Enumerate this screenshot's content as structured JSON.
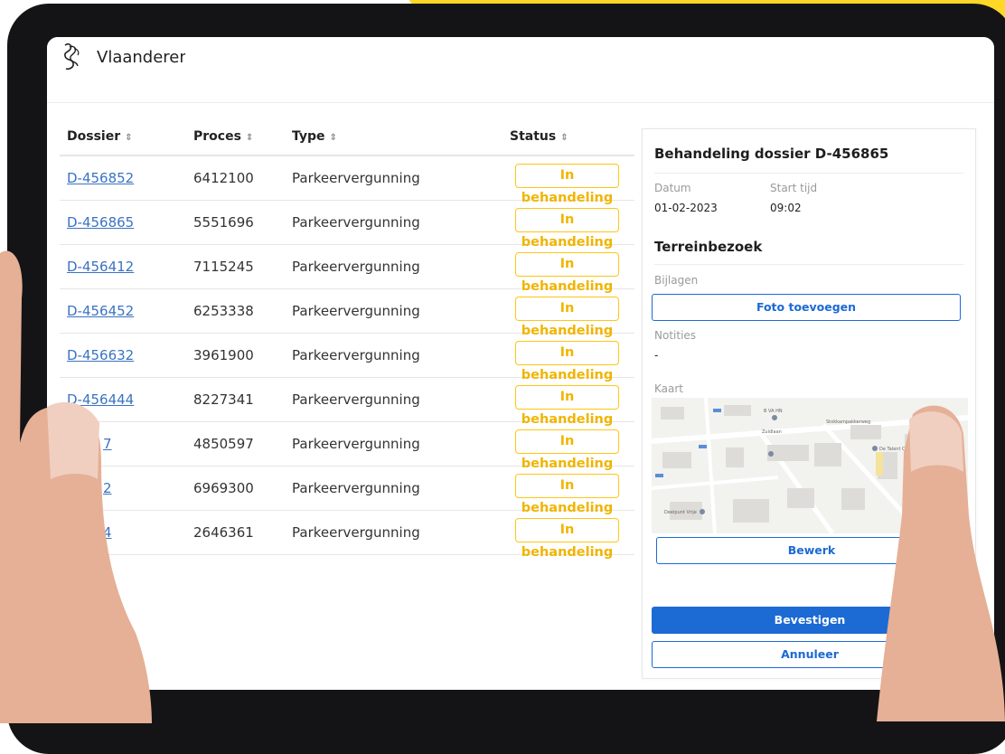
{
  "app": {
    "brand_name": "Vlaanderen",
    "accent": "#1c6ad3",
    "badge_color": "#ffc515"
  },
  "table": {
    "columns": [
      {
        "label": "Dossier",
        "sort_icon": "sort-icon"
      },
      {
        "label": "Proces",
        "sort_icon": "sort-icon"
      },
      {
        "label": "Type",
        "sort_icon": "sort-icon"
      },
      {
        "label": "Status",
        "sort_icon": "sort-icon"
      }
    ],
    "rows": [
      {
        "dossier": "D-456852",
        "proces": "6412100",
        "type": "Parkeervergunning",
        "status": "In behandeling"
      },
      {
        "dossier": "D-456865",
        "proces": "5551696",
        "type": "Parkeervergunning",
        "status": "In behandeling"
      },
      {
        "dossier": "D-456412",
        "proces": "7115245",
        "type": "Parkeervergunning",
        "status": "In behandeling"
      },
      {
        "dossier": "D-456452",
        "proces": "6253338",
        "type": "Parkeervergunning",
        "status": "In behandeling"
      },
      {
        "dossier": "D-456632",
        "proces": "3961900",
        "type": "Parkeervergunning",
        "status": "In behandeling"
      },
      {
        "dossier": "D-456444",
        "proces": "8227341",
        "type": "Parkeervergunning",
        "status": "In behandeling"
      },
      {
        "dossier": "7",
        "proces": "4850597",
        "type": "Parkeervergunning",
        "status": "In behandeling"
      },
      {
        "dossier": "2",
        "proces": "6969300",
        "type": "Parkeervergunning",
        "status": "In behandeling"
      },
      {
        "dossier": "4",
        "proces": "2646361",
        "type": "Parkeervergunning",
        "status": "In behandeling"
      }
    ]
  },
  "panel": {
    "title": "Behandeling dossier D-456865",
    "date_label": "Datum",
    "date_value": "01-02-2023",
    "time_label": "Start tijd",
    "time_value": "09:02",
    "section_title": "Terreinbezoek",
    "attachments_label": "Bijlagen",
    "add_photo_button": "Foto toevoegen",
    "notes_label": "Notities",
    "notes_value": "-",
    "map_label": "Kaart",
    "edit_button": "Bewerk",
    "confirm_button": "Bevestigen",
    "cancel_button": "Annuleer"
  },
  "map": {
    "streets": [
      "Zuidlaan",
      "Stokkampakkerweg",
      "Deelpunt Vrije"
    ],
    "places": [
      "B VA HN",
      "De Talent Coach"
    ]
  }
}
